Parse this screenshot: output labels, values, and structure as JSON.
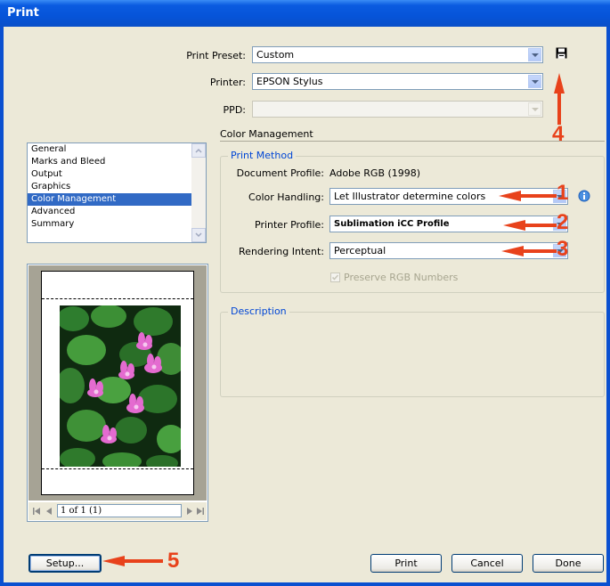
{
  "window": {
    "title": "Print"
  },
  "top": {
    "print_preset_label": "Print Preset:",
    "print_preset_value": "Custom",
    "printer_label": "Printer:",
    "printer_value": "EPSON Stylus",
    "ppd_label": "PPD:",
    "ppd_value": "",
    "section_title": "Color Management"
  },
  "sidebar": {
    "items": [
      {
        "label": "General"
      },
      {
        "label": "Marks and Bleed"
      },
      {
        "label": "Output"
      },
      {
        "label": "Graphics"
      },
      {
        "label": "Color Management",
        "selected": true
      },
      {
        "label": "Advanced"
      },
      {
        "label": "Summary"
      }
    ]
  },
  "preview": {
    "page_indicator": "1 of 1 (1)"
  },
  "print_method": {
    "legend": "Print Method",
    "document_profile_label": "Document Profile:",
    "document_profile_value": "Adobe RGB (1998)",
    "color_handling_label": "Color Handling:",
    "color_handling_value": "Let Illustrator determine colors",
    "printer_profile_label": "Printer Profile:",
    "printer_profile_value": "Sublimation iCC Profile",
    "rendering_intent_label": "Rendering Intent:",
    "rendering_intent_value": "Perceptual",
    "preserve_rgb_label": "Preserve RGB Numbers",
    "preserve_rgb_checked": true
  },
  "description": {
    "legend": "Description"
  },
  "buttons": {
    "setup": "Setup...",
    "print": "Print",
    "cancel": "Cancel",
    "done": "Done"
  },
  "annotations": {
    "n1": "1",
    "n2": "2",
    "n3": "3",
    "n4": "4",
    "n5": "5"
  },
  "colors": {
    "titlebar": "#0a5be0",
    "dialog_bg": "#ece9d8",
    "selection": "#316ac5",
    "legend_text": "#0046d5",
    "annotation": "#e8421b"
  }
}
